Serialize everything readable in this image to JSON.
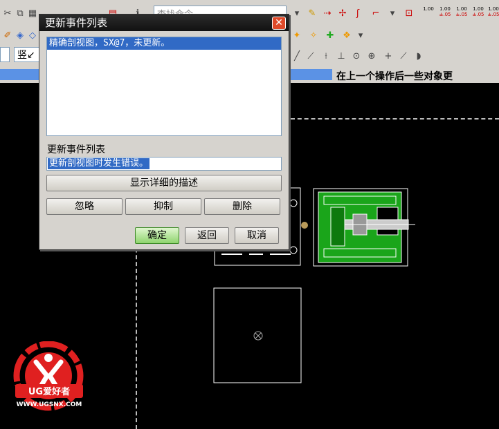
{
  "toolbar": {
    "search_placeholder": "查找命令",
    "dimension_buttons": [
      {
        "top": "1.00",
        "bottom": ""
      },
      {
        "top": "1.00",
        "bottom": "±.05"
      },
      {
        "top": "1.00",
        "bottom": "±.05"
      },
      {
        "top": "1.00",
        "bottom": "±.05"
      },
      {
        "top": "1.00",
        "bottom": "±.05"
      }
    ],
    "combo_value": "竖↙"
  },
  "status": {
    "message": "在上一个操作后一些对象更"
  },
  "dialog": {
    "title": "更新事件列表",
    "close_glyph": "✕",
    "list_items": [
      "精确剖视图，SX@7，未更新。"
    ],
    "field_label": "更新事件列表",
    "field_value": "更新剖视图时发生错误。",
    "detail_button": "显示详细的描述",
    "ignore_button": "忽略",
    "suppress_button": "抑制",
    "delete_button": "删除",
    "ok_button": "确定",
    "back_button": "返回",
    "cancel_button": "取消"
  },
  "logo": {
    "text": "UG爱好者",
    "url": "WWW.UGSNX.COM",
    "color": "#e02020"
  }
}
